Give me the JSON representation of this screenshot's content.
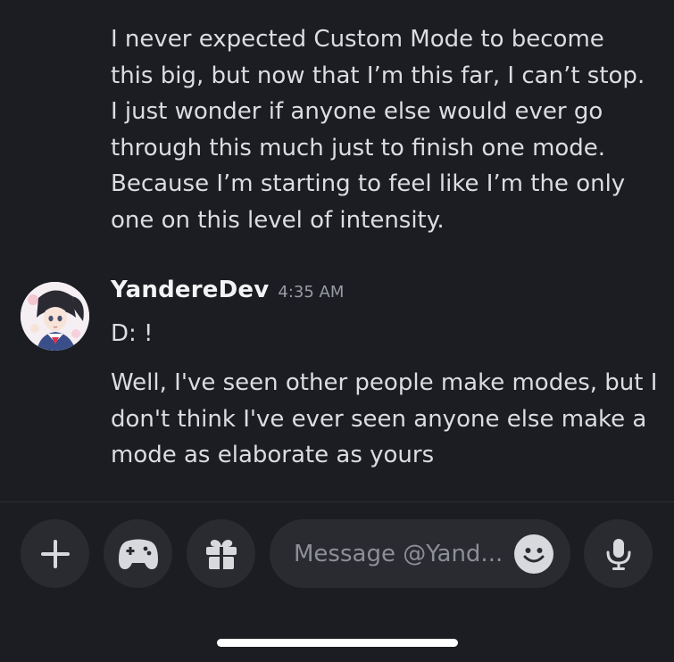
{
  "previous_message": {
    "lines": [
      "I never expected Custom Mode to become",
      "this big, but now that I’m this far, I can’t stop.",
      "I just wonder if anyone else would ever go",
      "through this much just to finish one mode.",
      "Because I’m starting to feel like I’m the only",
      "one on this level of intensity."
    ]
  },
  "message_group": {
    "username": "YandereDev",
    "timestamp": "4:35 AM",
    "messages": [
      {
        "lines": [
          "D: !"
        ]
      },
      {
        "lines": [
          "Well, I've seen other people make modes, but I",
          "don't think I've ever seen anyone else make a",
          "mode as elaborate as yours"
        ]
      }
    ]
  },
  "composer": {
    "placeholder": "Message @Yand...",
    "add_icon": "plus-icon",
    "game_icon": "gamepad-icon",
    "gift_icon": "gift-icon",
    "emoji_icon": "smiley-icon",
    "mic_icon": "microphone-icon"
  },
  "colors": {
    "background": "#1c1d22",
    "button_bg": "#2a2b31",
    "text": "#dcdde1",
    "username": "#f2f3f5",
    "muted": "#9a9ca4"
  }
}
